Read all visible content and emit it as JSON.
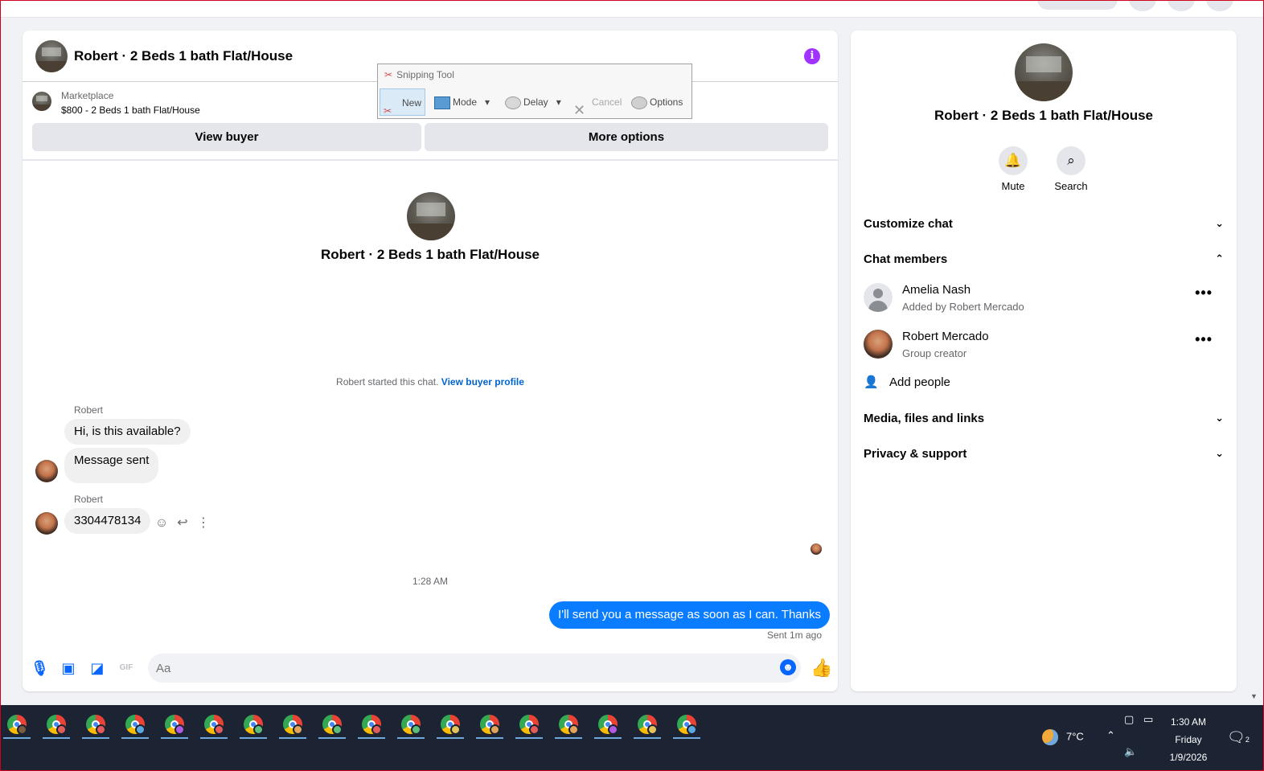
{
  "colors": {
    "accent": "#0866ff",
    "outgoing_bubble": "#0a7cff",
    "info": "#a033ff",
    "taskbar": "#1c2433"
  },
  "header": {
    "title": "Robert · 2 Beds 1 bath Flat/House",
    "info_icon": "info-icon"
  },
  "listing": {
    "label": "Marketplace",
    "price_title": "$800 - 2 Beds 1 bath Flat/House"
  },
  "buttons": {
    "view_buyer": "View buyer",
    "more_options": "More options"
  },
  "intro": {
    "title": "Robert · 2 Beds 1 bath Flat/House",
    "system_text": "Robert started this chat.",
    "system_link": "View buyer profile"
  },
  "messages": [
    {
      "sender": "Robert",
      "text": "Hi, is this available?"
    },
    {
      "text": "Message sent"
    },
    {
      "sender": "Robert",
      "text": "3304478134"
    }
  ],
  "timestamp": "1:28 AM",
  "outgoing": {
    "text": "I'll send you a message as soon as I can. Thanks",
    "status": "Sent 1m ago"
  },
  "composer": {
    "placeholder": "Aa",
    "icons": [
      "mic-icon",
      "photo-icon",
      "sticker-icon",
      "gif-icon",
      "emoji-icon",
      "like-icon"
    ],
    "gif_label": "GIF"
  },
  "snipping_tool": {
    "title": "Snipping Tool",
    "new": "New",
    "mode": "Mode",
    "delay": "Delay",
    "cancel": "Cancel",
    "options": "Options"
  },
  "right_panel": {
    "title": "Robert · 2 Beds 1 bath Flat/House",
    "mute": "Mute",
    "search": "Search",
    "customize_chat": "Customize chat",
    "chat_members": "Chat members",
    "members": [
      {
        "name": "Amelia Nash",
        "sub": "Added by Robert Mercado"
      },
      {
        "name": "Robert Mercado",
        "sub": "Group creator"
      }
    ],
    "add_people": "Add people",
    "media": "Media, files and links",
    "privacy": "Privacy & support"
  },
  "taskbar": {
    "apps": [
      "chrome",
      "chrome",
      "chrome",
      "chrome",
      "chrome",
      "chrome",
      "chrome",
      "chrome",
      "chrome",
      "chrome",
      "chrome",
      "chrome",
      "chrome",
      "chrome",
      "chrome",
      "chrome",
      "chrome",
      "chrome"
    ],
    "temperature": "7°C",
    "time": "1:30 AM",
    "day": "Friday",
    "date": "1/9/2026",
    "notifications": "2"
  }
}
